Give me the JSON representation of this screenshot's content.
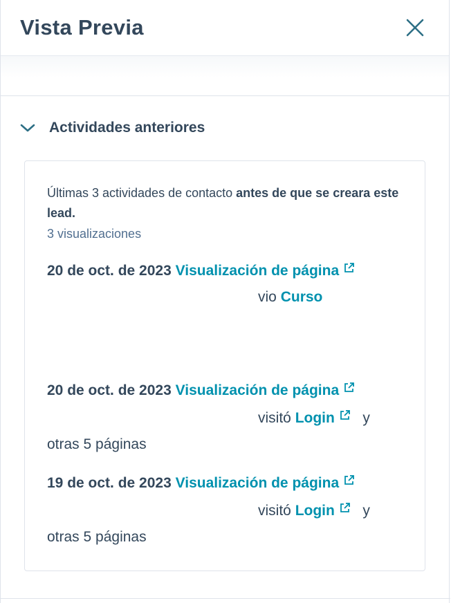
{
  "header": {
    "title": "Vista Previa",
    "close_icon": "close-icon"
  },
  "section": {
    "title": "Actividades anteriores",
    "expanded": true
  },
  "card": {
    "intro_prefix": "Últimas 3 actividades de contacto ",
    "intro_bold": "antes de que se creara este lead.",
    "views_count": "3 visualizaciones",
    "activities": [
      {
        "date": "20 de oct. de 2023",
        "type": "Visualización de página",
        "verb": "vio",
        "page": "Curso",
        "extra": ""
      },
      {
        "date": "20 de oct. de 2023",
        "type": "Visualización de página",
        "verb": "visitó",
        "page": "Login",
        "conj": "y",
        "extra": "otras 5 páginas"
      },
      {
        "date": "19 de oct. de 2023",
        "type": "Visualización de página",
        "verb": "visitó",
        "page": "Login",
        "conj": "y",
        "extra": "otras 5 páginas"
      }
    ]
  },
  "colors": {
    "text": "#33475b",
    "link": "#0091ae",
    "secondary": "#516f90",
    "border": "#dfe3eb"
  }
}
